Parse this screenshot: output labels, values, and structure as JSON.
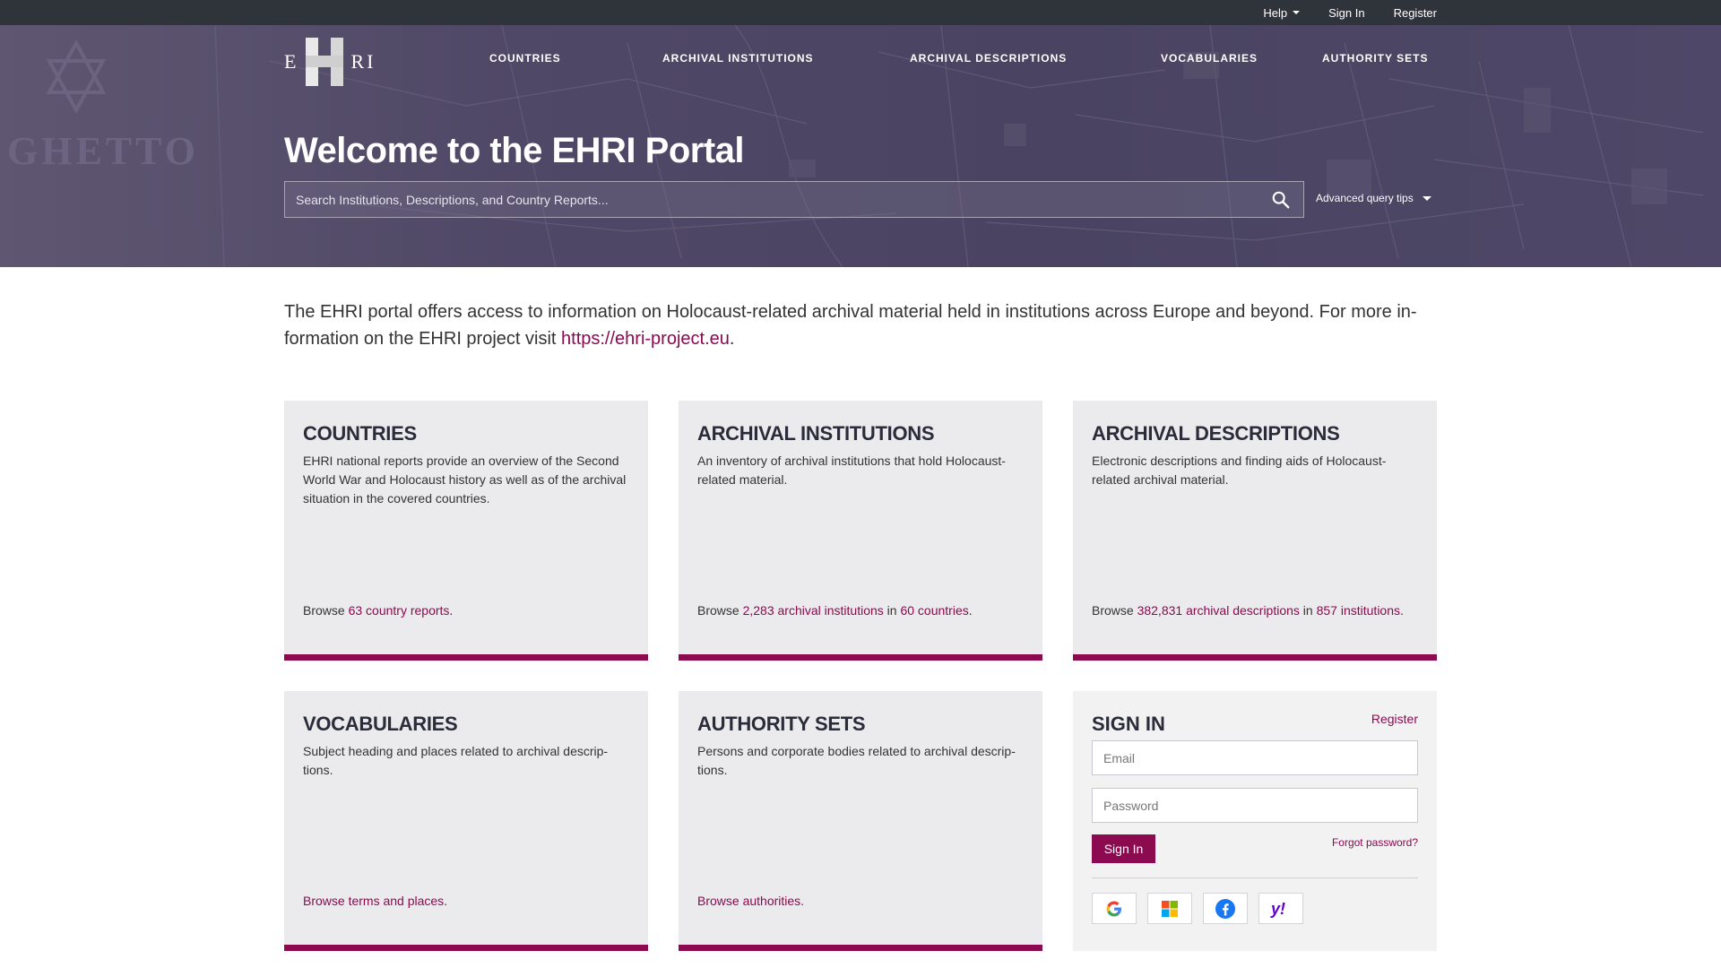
{
  "topbar": {
    "help": "Help",
    "sign_in": "Sign In",
    "register": "Register"
  },
  "logo": {
    "left": "E",
    "right": "RI"
  },
  "nav": {
    "countries": "COUNTRIES",
    "institutions": "ARCHIVAL INSTITUTIONS",
    "descriptions": "ARCHIVAL DESCRIPTIONS",
    "vocabularies": "VOCABULARIES",
    "authority_sets": "AUTHORITY SETS"
  },
  "hero": {
    "title": "Welcome to the EHRI Portal",
    "search_placeholder": "Search Institutions, Descriptions, and Country Reports...",
    "advanced_tips": "Advanced query tips",
    "watermark": "GHETTO"
  },
  "intro": {
    "text": "The EHRI portal offers access to information on Holocaust-related archival material held in institutions across Europe and beyond. For more in-formation on the EHRI project visit ",
    "link": "https://ehri-project.eu",
    "end": "."
  },
  "cards": {
    "countries": {
      "title": "COUNTRIES",
      "desc": "EHRI national reports provide an overview of the Second World War and Holocaust history as well as of the archival situation in the covered countries.",
      "browse_prefix": "Browse ",
      "browse_link": "63 country reports",
      "browse_suffix": "."
    },
    "institutions": {
      "title": "ARCHIVAL INSTITUTIONS",
      "desc": "An inventory of archival institutions that hold Holocaust-related material.",
      "browse_prefix": "Browse ",
      "browse_link": "2,283 archival institutions",
      "browse_mid": " in ",
      "browse_link2": "60 countries",
      "browse_suffix": "."
    },
    "descriptions": {
      "title": "ARCHIVAL DESCRIPTIONS",
      "desc": "Electronic descriptions and finding aids of Holocaust-related archival material.",
      "browse_prefix": "Browse ",
      "browse_link": "382,831 archival descriptions",
      "browse_mid": " in ",
      "browse_link2": "857 institutions",
      "browse_suffix": "."
    },
    "vocabularies": {
      "title": "VOCABULARIES",
      "desc": "Subject heading and places related to archival descrip-tions.",
      "browse_link": "Browse terms and places."
    },
    "authority_sets": {
      "title": "AUTHORITY SETS",
      "desc": "Persons and corporate bodies related to archival descrip-tions.",
      "browse_link": "Browse authorities."
    }
  },
  "signin": {
    "title": "SIGN IN",
    "register": "Register",
    "email_placeholder": "Email",
    "password_placeholder": "Password",
    "button": "Sign In",
    "forgot": "Forgot password?",
    "providers": [
      "google-icon",
      "microsoft-icon",
      "facebook-icon",
      "yahoo-icon"
    ]
  },
  "colors": {
    "accent": "#8b0a50",
    "topbar": "#2f333a",
    "hero": "#4f4866",
    "card_bg": "#ebebed"
  }
}
